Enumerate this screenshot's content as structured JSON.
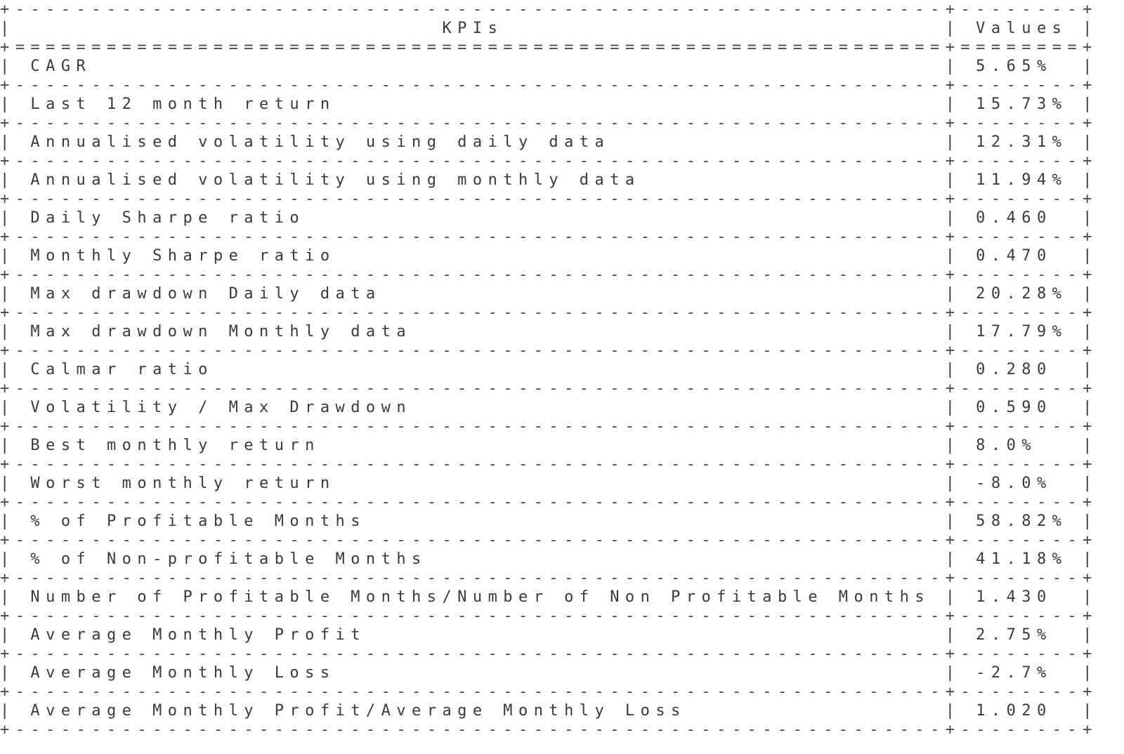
{
  "table": {
    "headers": [
      "KPIs",
      "Values"
    ],
    "rows": [
      {
        "kpi": "CAGR",
        "value": "5.65%"
      },
      {
        "kpi": "Last 12 month return",
        "value": "15.73%"
      },
      {
        "kpi": "Annualised volatility using daily data",
        "value": "12.31%"
      },
      {
        "kpi": "Annualised volatility using monthly data",
        "value": "11.94%"
      },
      {
        "kpi": "Daily Sharpe ratio",
        "value": "0.460"
      },
      {
        "kpi": "Monthly Sharpe ratio",
        "value": "0.470"
      },
      {
        "kpi": "Max drawdown Daily data",
        "value": "20.28%"
      },
      {
        "kpi": "Max drawdown Monthly data",
        "value": "17.79%"
      },
      {
        "kpi": "Calmar ratio",
        "value": "0.280"
      },
      {
        "kpi": "Volatility / Max Drawdown",
        "value": "0.590"
      },
      {
        "kpi": "Best monthly return",
        "value": "8.0%"
      },
      {
        "kpi": "Worst monthly return",
        "value": "-8.0%"
      },
      {
        "kpi": "% of Profitable Months",
        "value": "58.82%"
      },
      {
        "kpi": "% of Non-profitable Months",
        "value": "41.18%"
      },
      {
        "kpi": "Number of Profitable Months/Number of Non Profitable Months",
        "value": "1.430"
      },
      {
        "kpi": "Average Monthly Profit",
        "value": "2.75%"
      },
      {
        "kpi": "Average Monthly Loss",
        "value": "-2.7%"
      },
      {
        "kpi": "Average Monthly Profit/Average Monthly Loss",
        "value": "1.020"
      }
    ]
  }
}
